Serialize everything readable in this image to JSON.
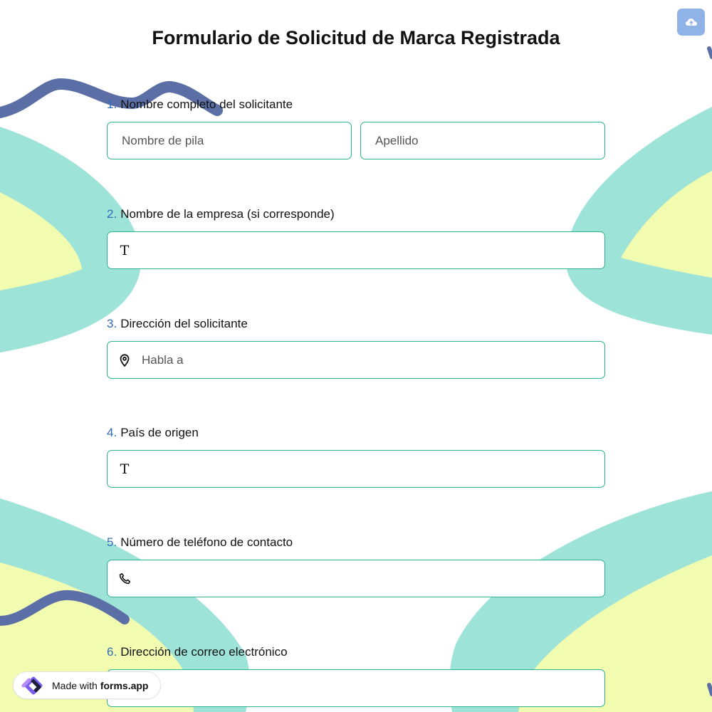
{
  "form": {
    "title": "Formulario de Solicitud de Marca Registrada",
    "questions": [
      {
        "number": "1.",
        "label": "Nombre completo del solicitante",
        "fields": [
          {
            "placeholder": "Nombre de pila"
          },
          {
            "placeholder": "Apellido"
          }
        ]
      },
      {
        "number": "2.",
        "label": "Nombre de la empresa (si corresponde)",
        "icon": "text-icon",
        "placeholder": ""
      },
      {
        "number": "3.",
        "label": "Dirección del solicitante",
        "icon": "location-pin-icon",
        "placeholder": "Habla a"
      },
      {
        "number": "4.",
        "label": "País de origen",
        "icon": "text-icon",
        "placeholder": ""
      },
      {
        "number": "5.",
        "label": "Número de teléfono de contacto",
        "icon": "phone-icon",
        "placeholder": ""
      },
      {
        "number": "6.",
        "label": "Dirección de correo electrónico",
        "icon": "",
        "placeholder": ""
      }
    ]
  },
  "badge": {
    "prefix": "Made with",
    "brand": "forms.app"
  },
  "toolbar": {
    "upload_icon": "cloud-upload-icon"
  },
  "colors": {
    "accent": "#2bb28e",
    "number": "#2d6db5",
    "teal_blob": "#9de3d8",
    "yellow_blob": "#f2fcb0",
    "navy_squiggle": "#5b6fa6",
    "upload_button": "#8fb3e6"
  }
}
